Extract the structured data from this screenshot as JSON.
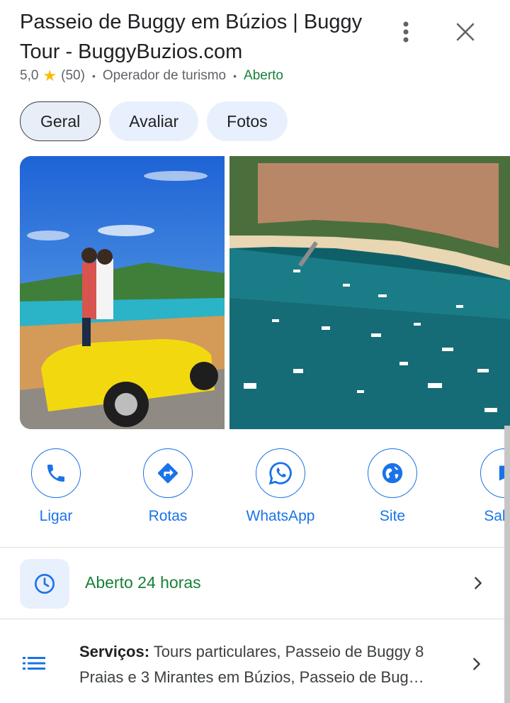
{
  "header": {
    "title": "Passeio de Buggy em Búzios | Buggy Tour - BuggyBuzios.com",
    "rating": "5,0",
    "reviews": "(50)",
    "category": "Operador de turismo",
    "status": "Aberto"
  },
  "tabs": [
    {
      "label": "Geral"
    },
    {
      "label": "Avaliar"
    },
    {
      "label": "Fotos"
    }
  ],
  "actions": [
    {
      "label": "Ligar",
      "icon": "phone-icon"
    },
    {
      "label": "Rotas",
      "icon": "directions-icon"
    },
    {
      "label": "WhatsApp",
      "icon": "whatsapp-icon"
    },
    {
      "label": "Site",
      "icon": "globe-icon"
    },
    {
      "label": "Salvar",
      "icon": "bookmark-icon"
    }
  ],
  "hours": {
    "text": "Aberto 24 horas",
    "icon": "clock-icon"
  },
  "services": {
    "label": "Serviços:",
    "text": " Tours particulares, Passeio de Buggy 8 Praias e 3 Mirantes em Búzios, Passeio de Bug…",
    "icon": "list-icon"
  },
  "colors": {
    "accent": "#1a73e8",
    "open": "#188038",
    "star": "#fbbc04",
    "chip": "#e8f0fe"
  }
}
